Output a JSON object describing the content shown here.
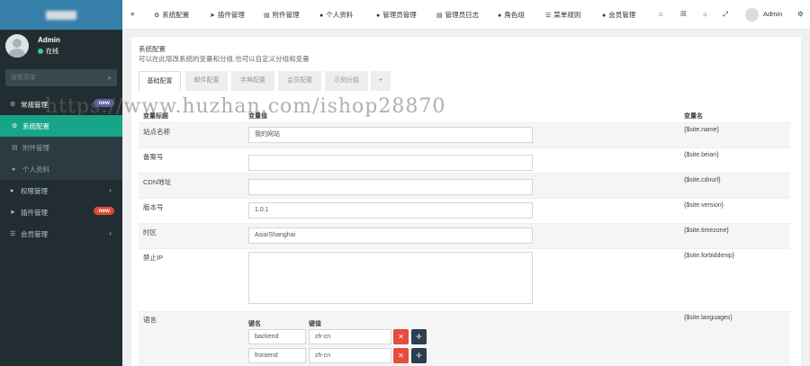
{
  "sidebar": {
    "user_name": "Admin",
    "user_status": "在线",
    "search_placeholder": "搜索菜单",
    "items": [
      {
        "label": "常规管理",
        "icon": "gears-icon",
        "badge": "new"
      },
      {
        "label": "系统配置",
        "icon": "gear-icon"
      },
      {
        "label": "附件管理",
        "icon": "file-image-icon"
      },
      {
        "label": "个人资料",
        "icon": "user-icon"
      },
      {
        "label": "权限管理",
        "icon": "users-icon"
      },
      {
        "label": "插件管理",
        "icon": "rocket-icon",
        "badge": "new"
      },
      {
        "label": "会员管理",
        "icon": "list-icon"
      }
    ]
  },
  "topbar": {
    "nav": [
      {
        "label": "系统配置",
        "icon": "gears-icon"
      },
      {
        "label": "插件管理",
        "icon": "rocket-icon"
      },
      {
        "label": "附件管理",
        "icon": "file-image-icon"
      },
      {
        "label": "个人资料",
        "icon": "user-icon"
      },
      {
        "label": "管理员管理",
        "icon": "user-icon"
      },
      {
        "label": "管理员日志",
        "icon": "list-alt-icon"
      },
      {
        "label": "角色组",
        "icon": "group-icon"
      },
      {
        "label": "菜单规则",
        "icon": "bars-icon"
      },
      {
        "label": "会员管理",
        "icon": "user-icon"
      }
    ],
    "user": "Admin"
  },
  "panel": {
    "title": "系统配置",
    "description": "可以在此增改系统的变量和分组,也可以自定义分组和变量",
    "tabs": [
      "基础配置",
      "邮件配置",
      "字典配置",
      "会员配置",
      "示例分组",
      "+"
    ]
  },
  "table": {
    "headers": [
      "变量标题",
      "变量值",
      "变量名"
    ],
    "rows": [
      {
        "label": "站点名称",
        "value": "我的网站",
        "var": "{$site.name}"
      },
      {
        "label": "备案号",
        "value": "",
        "var": "{$site.beian}"
      },
      {
        "label": "CDN地址",
        "value": "",
        "var": "{$site.cdnurl}"
      },
      {
        "label": "版本号",
        "value": "1.0.1",
        "var": "{$site.version}"
      },
      {
        "label": "时区",
        "value": "Asia/Shanghai",
        "var": "{$site.timezone}"
      },
      {
        "label": "禁止IP",
        "value": "",
        "var": "{$site.forbiddenip}"
      }
    ],
    "languages": {
      "label": "语言",
      "var": "{$site.languages}",
      "key_header": "键名",
      "value_header": "键值",
      "pairs": [
        {
          "key": "backend",
          "value": "zh-cn"
        },
        {
          "key": "frontend",
          "value": "zh-cn"
        }
      ]
    }
  },
  "watermark": "https://www.huzhan.com/ishop28870",
  "colors": {
    "sidebar": "#222d32",
    "logo": "#367fa9",
    "active_menu": "#17a589",
    "badge_new": "#605ca8",
    "badge_red": "#dd4b39",
    "delete_button": "#e74c3c",
    "move_button": "#2c3e50"
  }
}
